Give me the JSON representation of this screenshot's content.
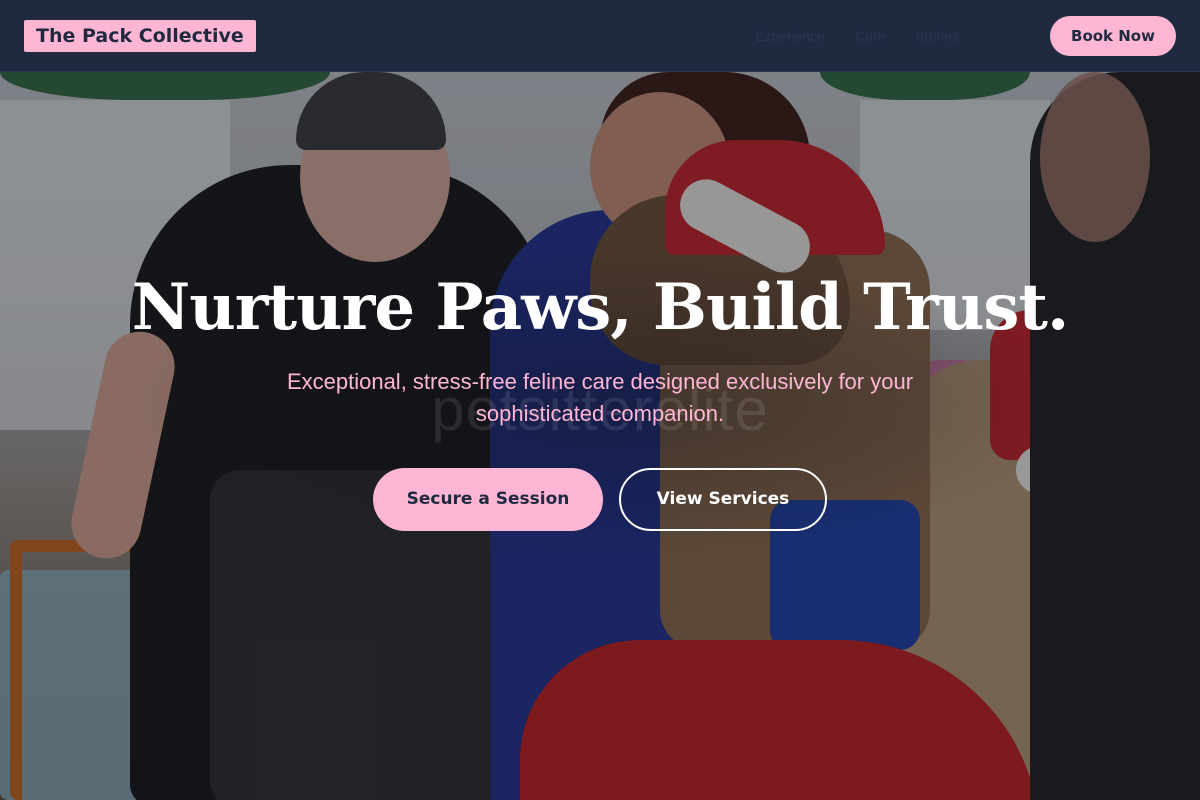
{
  "brand": {
    "name": "The Pack Collective"
  },
  "nav": {
    "items": [
      "Experience",
      "Care",
      "Stories"
    ]
  },
  "header": {
    "cta_label": "Book Now"
  },
  "hero": {
    "title": "Nurture Paws, Build Trust.",
    "subtitle": "Exceptional, stress-free feline care designed exclusively for your sophisticated companion.",
    "watermark": "petsitterelite",
    "primary_cta": "Secure a Session",
    "secondary_cta": "View Services",
    "image_description_icon": "hero-photo"
  },
  "colors": {
    "accent_pink": "#ffb6d5",
    "header_navy": "#1f2a40",
    "title_white": "#ffffff"
  }
}
